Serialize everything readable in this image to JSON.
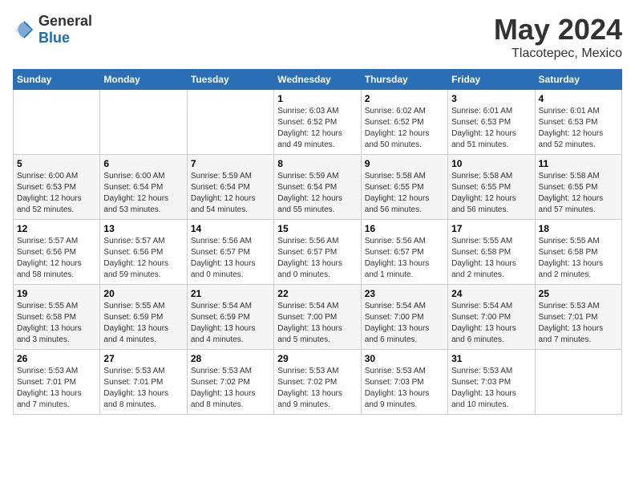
{
  "header": {
    "logo_general": "General",
    "logo_blue": "Blue",
    "month": "May 2024",
    "location": "Tlacotepec, Mexico"
  },
  "weekdays": [
    "Sunday",
    "Monday",
    "Tuesday",
    "Wednesday",
    "Thursday",
    "Friday",
    "Saturday"
  ],
  "weeks": [
    [
      {
        "day": "",
        "sunrise": "",
        "sunset": "",
        "daylight": ""
      },
      {
        "day": "",
        "sunrise": "",
        "sunset": "",
        "daylight": ""
      },
      {
        "day": "",
        "sunrise": "",
        "sunset": "",
        "daylight": ""
      },
      {
        "day": "1",
        "sunrise": "Sunrise: 6:03 AM",
        "sunset": "Sunset: 6:52 PM",
        "daylight": "Daylight: 12 hours and 49 minutes."
      },
      {
        "day": "2",
        "sunrise": "Sunrise: 6:02 AM",
        "sunset": "Sunset: 6:52 PM",
        "daylight": "Daylight: 12 hours and 50 minutes."
      },
      {
        "day": "3",
        "sunrise": "Sunrise: 6:01 AM",
        "sunset": "Sunset: 6:53 PM",
        "daylight": "Daylight: 12 hours and 51 minutes."
      },
      {
        "day": "4",
        "sunrise": "Sunrise: 6:01 AM",
        "sunset": "Sunset: 6:53 PM",
        "daylight": "Daylight: 12 hours and 52 minutes."
      }
    ],
    [
      {
        "day": "5",
        "sunrise": "Sunrise: 6:00 AM",
        "sunset": "Sunset: 6:53 PM",
        "daylight": "Daylight: 12 hours and 52 minutes."
      },
      {
        "day": "6",
        "sunrise": "Sunrise: 6:00 AM",
        "sunset": "Sunset: 6:54 PM",
        "daylight": "Daylight: 12 hours and 53 minutes."
      },
      {
        "day": "7",
        "sunrise": "Sunrise: 5:59 AM",
        "sunset": "Sunset: 6:54 PM",
        "daylight": "Daylight: 12 hours and 54 minutes."
      },
      {
        "day": "8",
        "sunrise": "Sunrise: 5:59 AM",
        "sunset": "Sunset: 6:54 PM",
        "daylight": "Daylight: 12 hours and 55 minutes."
      },
      {
        "day": "9",
        "sunrise": "Sunrise: 5:58 AM",
        "sunset": "Sunset: 6:55 PM",
        "daylight": "Daylight: 12 hours and 56 minutes."
      },
      {
        "day": "10",
        "sunrise": "Sunrise: 5:58 AM",
        "sunset": "Sunset: 6:55 PM",
        "daylight": "Daylight: 12 hours and 56 minutes."
      },
      {
        "day": "11",
        "sunrise": "Sunrise: 5:58 AM",
        "sunset": "Sunset: 6:55 PM",
        "daylight": "Daylight: 12 hours and 57 minutes."
      }
    ],
    [
      {
        "day": "12",
        "sunrise": "Sunrise: 5:57 AM",
        "sunset": "Sunset: 6:56 PM",
        "daylight": "Daylight: 12 hours and 58 minutes."
      },
      {
        "day": "13",
        "sunrise": "Sunrise: 5:57 AM",
        "sunset": "Sunset: 6:56 PM",
        "daylight": "Daylight: 12 hours and 59 minutes."
      },
      {
        "day": "14",
        "sunrise": "Sunrise: 5:56 AM",
        "sunset": "Sunset: 6:57 PM",
        "daylight": "Daylight: 13 hours and 0 minutes."
      },
      {
        "day": "15",
        "sunrise": "Sunrise: 5:56 AM",
        "sunset": "Sunset: 6:57 PM",
        "daylight": "Daylight: 13 hours and 0 minutes."
      },
      {
        "day": "16",
        "sunrise": "Sunrise: 5:56 AM",
        "sunset": "Sunset: 6:57 PM",
        "daylight": "Daylight: 13 hours and 1 minute."
      },
      {
        "day": "17",
        "sunrise": "Sunrise: 5:55 AM",
        "sunset": "Sunset: 6:58 PM",
        "daylight": "Daylight: 13 hours and 2 minutes."
      },
      {
        "day": "18",
        "sunrise": "Sunrise: 5:55 AM",
        "sunset": "Sunset: 6:58 PM",
        "daylight": "Daylight: 13 hours and 2 minutes."
      }
    ],
    [
      {
        "day": "19",
        "sunrise": "Sunrise: 5:55 AM",
        "sunset": "Sunset: 6:58 PM",
        "daylight": "Daylight: 13 hours and 3 minutes."
      },
      {
        "day": "20",
        "sunrise": "Sunrise: 5:55 AM",
        "sunset": "Sunset: 6:59 PM",
        "daylight": "Daylight: 13 hours and 4 minutes."
      },
      {
        "day": "21",
        "sunrise": "Sunrise: 5:54 AM",
        "sunset": "Sunset: 6:59 PM",
        "daylight": "Daylight: 13 hours and 4 minutes."
      },
      {
        "day": "22",
        "sunrise": "Sunrise: 5:54 AM",
        "sunset": "Sunset: 7:00 PM",
        "daylight": "Daylight: 13 hours and 5 minutes."
      },
      {
        "day": "23",
        "sunrise": "Sunrise: 5:54 AM",
        "sunset": "Sunset: 7:00 PM",
        "daylight": "Daylight: 13 hours and 6 minutes."
      },
      {
        "day": "24",
        "sunrise": "Sunrise: 5:54 AM",
        "sunset": "Sunset: 7:00 PM",
        "daylight": "Daylight: 13 hours and 6 minutes."
      },
      {
        "day": "25",
        "sunrise": "Sunrise: 5:53 AM",
        "sunset": "Sunset: 7:01 PM",
        "daylight": "Daylight: 13 hours and 7 minutes."
      }
    ],
    [
      {
        "day": "26",
        "sunrise": "Sunrise: 5:53 AM",
        "sunset": "Sunset: 7:01 PM",
        "daylight": "Daylight: 13 hours and 7 minutes."
      },
      {
        "day": "27",
        "sunrise": "Sunrise: 5:53 AM",
        "sunset": "Sunset: 7:01 PM",
        "daylight": "Daylight: 13 hours and 8 minutes."
      },
      {
        "day": "28",
        "sunrise": "Sunrise: 5:53 AM",
        "sunset": "Sunset: 7:02 PM",
        "daylight": "Daylight: 13 hours and 8 minutes."
      },
      {
        "day": "29",
        "sunrise": "Sunrise: 5:53 AM",
        "sunset": "Sunset: 7:02 PM",
        "daylight": "Daylight: 13 hours and 9 minutes."
      },
      {
        "day": "30",
        "sunrise": "Sunrise: 5:53 AM",
        "sunset": "Sunset: 7:03 PM",
        "daylight": "Daylight: 13 hours and 9 minutes."
      },
      {
        "day": "31",
        "sunrise": "Sunrise: 5:53 AM",
        "sunset": "Sunset: 7:03 PM",
        "daylight": "Daylight: 13 hours and 10 minutes."
      },
      {
        "day": "",
        "sunrise": "",
        "sunset": "",
        "daylight": ""
      }
    ]
  ]
}
